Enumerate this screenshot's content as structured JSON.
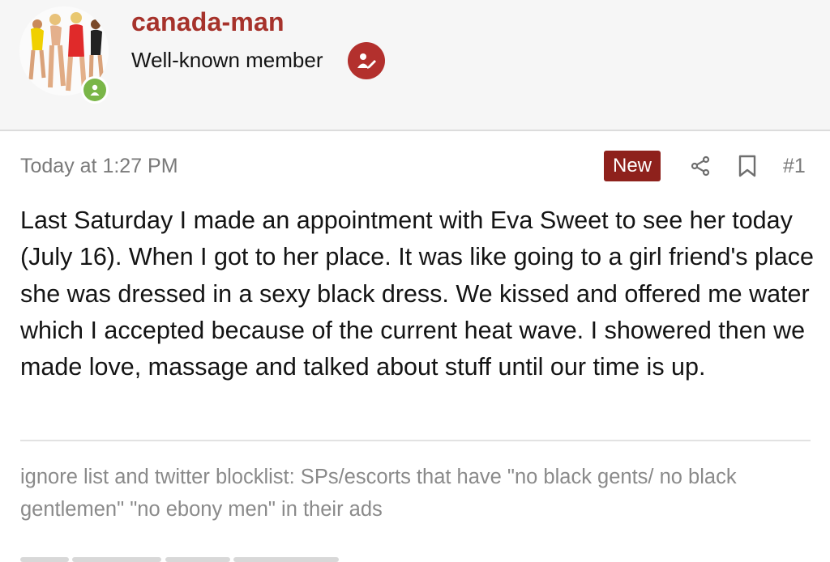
{
  "author": {
    "username": "canada-man",
    "role": "Well-known member",
    "avatar_icon": "avatar-photo",
    "online_icon": "online-user-icon",
    "role_badge_icon": "staff-pencil-icon"
  },
  "post": {
    "timestamp": "Today at 1:27 PM",
    "new_label": "New",
    "share_icon": "share-icon",
    "bookmark_icon": "bookmark-icon",
    "number": "#1",
    "body": "Last Saturday I made an appointment with Eva Sweet to see her today (July 16). When I got to her place. It was like going to a girl friend's place she was dressed in a sexy black dress. We kissed and offered me water which I accepted because of the current heat wave. I showered then we made love, massage and talked about stuff until our time is up.",
    "signature": "ignore list and twitter blocklist: SPs/escorts that have \"no black gents/ no black gentlemen\" \"no ebony men\" in their ads"
  },
  "colors": {
    "accent": "#a6322b",
    "new_badge": "#8e211c",
    "online": "#7ab648",
    "muted": "#7a7a7a"
  }
}
